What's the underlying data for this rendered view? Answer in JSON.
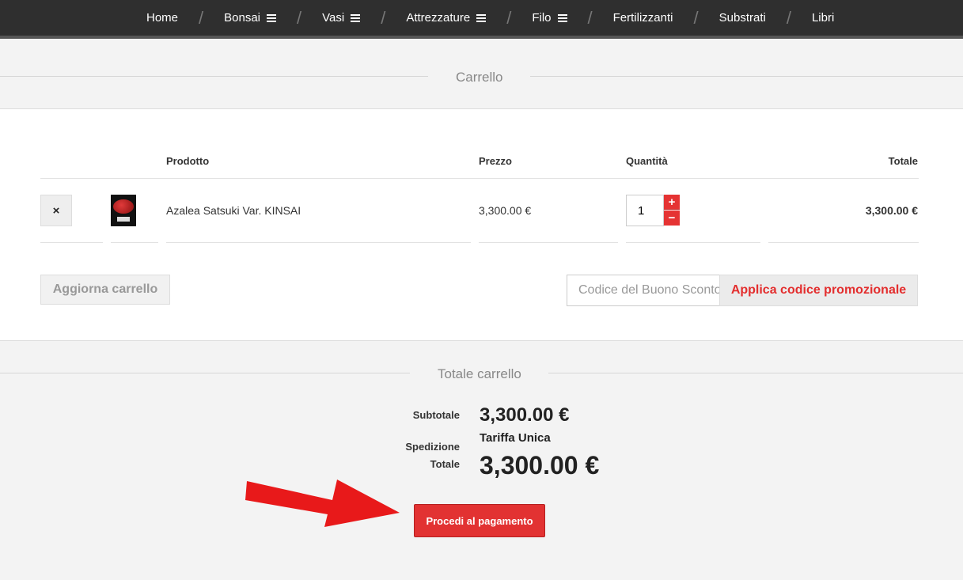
{
  "nav": {
    "items": [
      {
        "label": "Home",
        "menu": false
      },
      {
        "label": "Bonsai",
        "menu": true
      },
      {
        "label": "Vasi",
        "menu": true
      },
      {
        "label": "Attrezzature",
        "menu": true
      },
      {
        "label": "Filo",
        "menu": true
      },
      {
        "label": "Fertilizzanti",
        "menu": false
      },
      {
        "label": "Substrati",
        "menu": false
      },
      {
        "label": "Libri",
        "menu": false
      }
    ],
    "separator": "/"
  },
  "cart": {
    "title": "Carrello",
    "headers": {
      "product": "Prodotto",
      "price": "Prezzo",
      "quantity": "Quantità",
      "total": "Totale"
    },
    "item": {
      "remove_icon": "×",
      "name": "Azalea Satsuki Var. KINSAI",
      "price": "3,300.00 €",
      "quantity": "1",
      "total": "3,300.00 €"
    },
    "update_label": "Aggiorna carrello",
    "coupon_placeholder": "Codice del Buono Sconto",
    "apply_label": "Applica codice promozionale"
  },
  "totals": {
    "title": "Totale carrello",
    "subtotal_label": "Subtotale",
    "subtotal_value": "3,300.00 €",
    "shipping_label": "Spedizione",
    "shipping_value": "Tariffa Unica",
    "total_label": "Totale",
    "total_value": "3,300.00 €",
    "checkout_label": "Procedi al pagamento"
  },
  "colors": {
    "accent": "#e23232",
    "nav_bg": "#2f2f2f"
  }
}
